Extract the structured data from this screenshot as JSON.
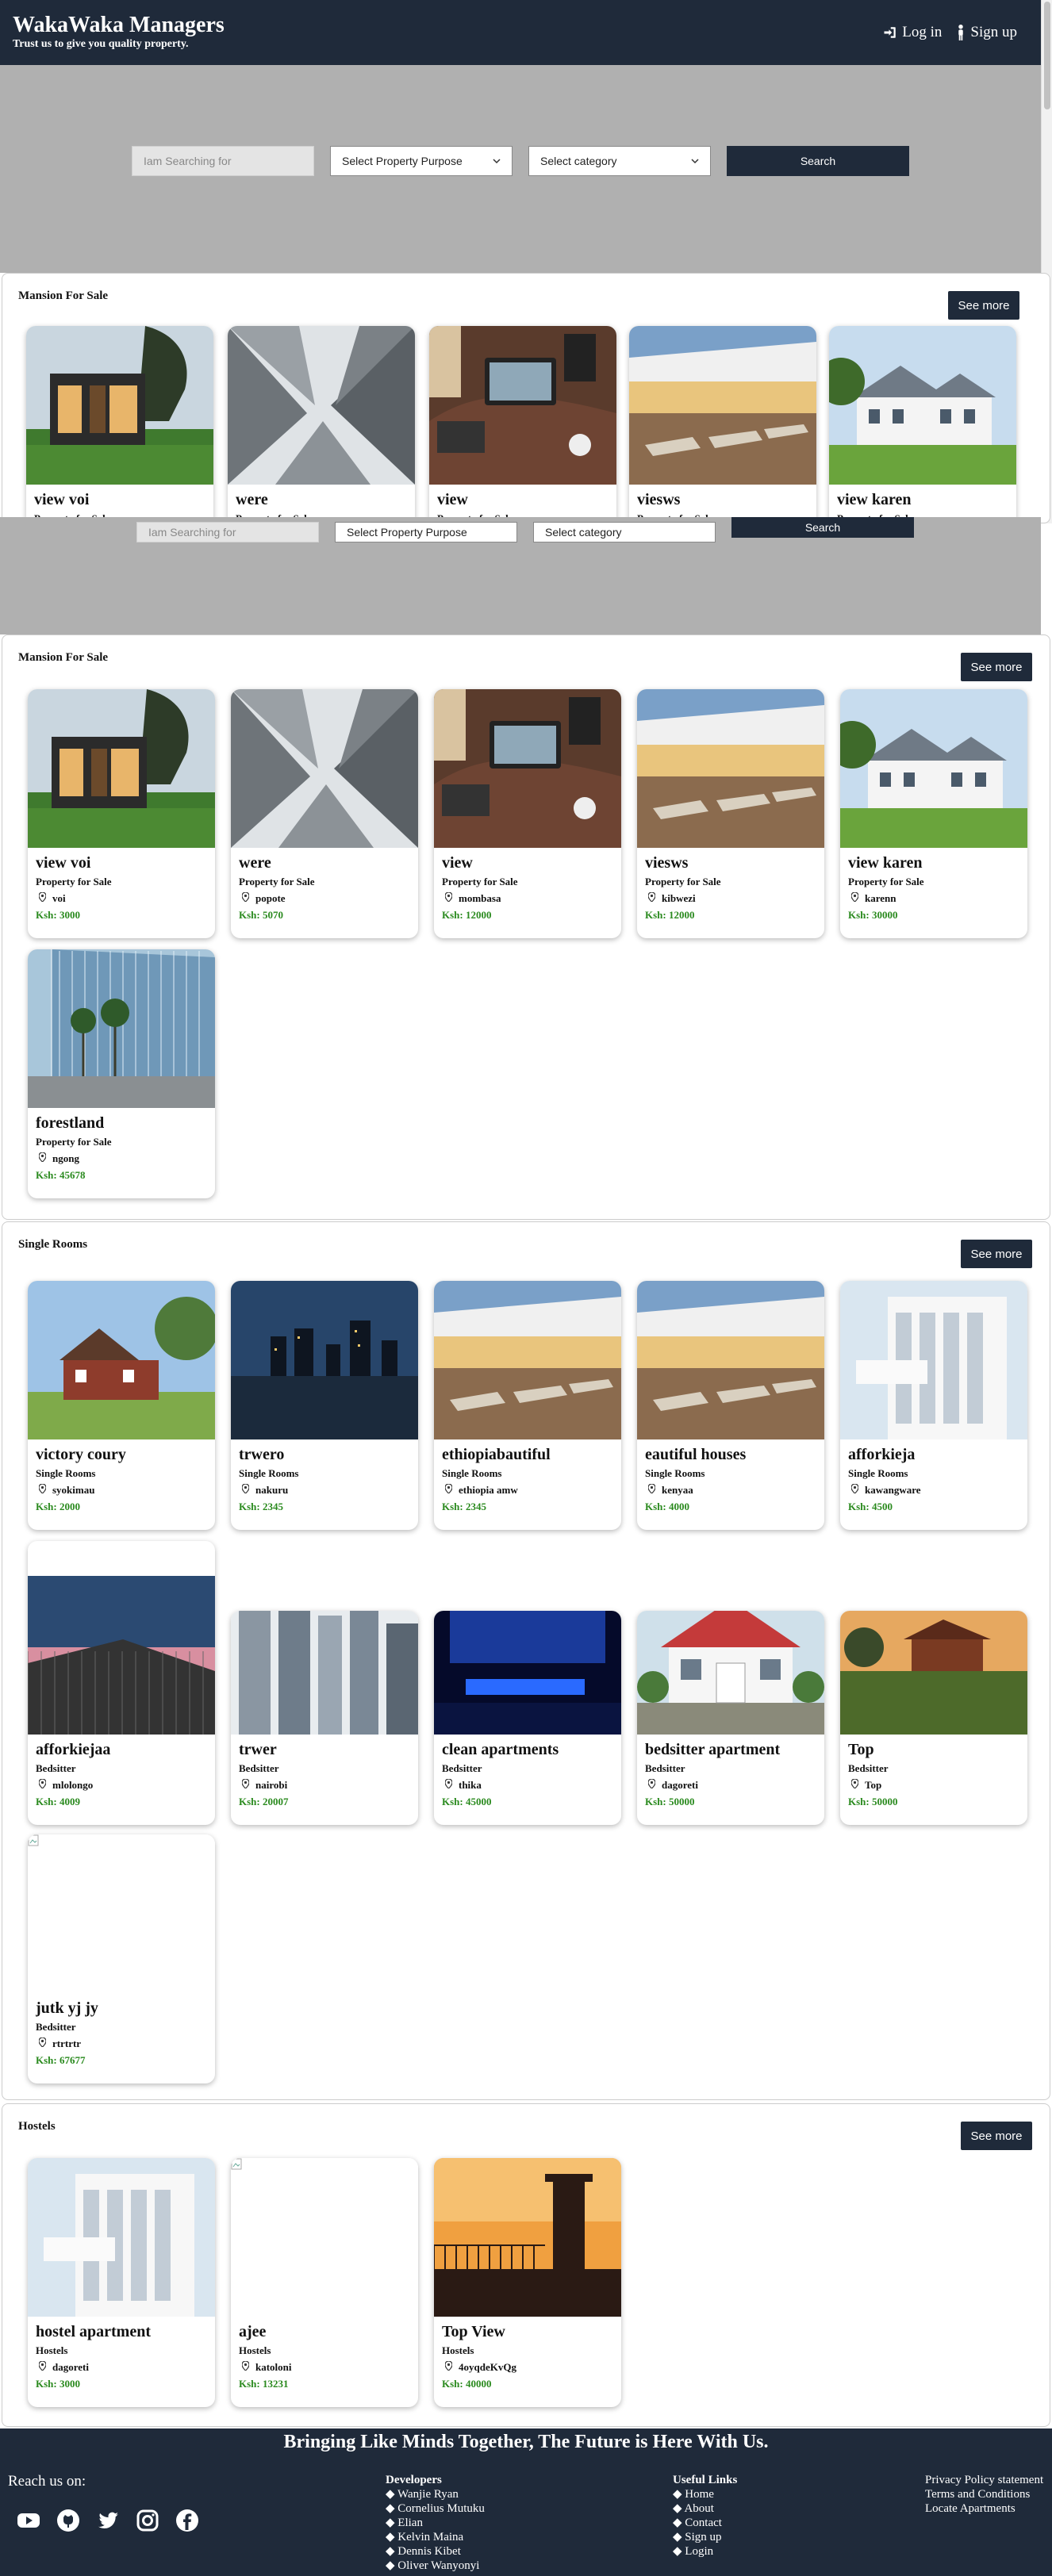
{
  "header": {
    "brand": "WakaWaka Managers",
    "tagline": "Trust us to give you quality property.",
    "login": "Log in",
    "signup": "Sign up"
  },
  "search": {
    "placeholder": "Iam Searching for",
    "purpose": "Select Property Purpose",
    "category": "Select category",
    "button": "Search"
  },
  "see_more": "See more",
  "sections": {
    "sale": {
      "title": "Mansion For Sale",
      "cards": [
        {
          "title": "view voi",
          "category": "Property for Sale",
          "location": "voi",
          "price": "Ksh: 3000",
          "image": "modern-house-trees"
        },
        {
          "title": "were",
          "category": "Property for Sale",
          "location": "popote",
          "price": "Ksh: 5070",
          "image": "skyscrapers-looking-up"
        },
        {
          "title": "view",
          "category": "Property for Sale",
          "location": "mombasa",
          "price": "Ksh: 12000",
          "image": "office-desk"
        },
        {
          "title": "viesws",
          "category": "Property for Sale",
          "location": "kibwezi",
          "price": "Ksh: 12000",
          "image": "patio-lounge"
        },
        {
          "title": "view karen",
          "category": "Property for Sale",
          "location": "karenn",
          "price": "Ksh: 30000",
          "image": "white-house-lawn"
        },
        {
          "title": "forestland",
          "category": "Property for Sale",
          "location": "ngong",
          "price": "Ksh: 45678",
          "image": "glass-building-palms"
        }
      ]
    },
    "single": {
      "title": "Single Rooms",
      "cards": [
        {
          "title": "victory coury",
          "category": "Single Rooms",
          "location": "syokimau",
          "price": "Ksh: 2000",
          "image": "brick-house"
        },
        {
          "title": "trwero",
          "category": "Single Rooms",
          "location": "nakuru",
          "price": "Ksh: 2345",
          "image": "city-skyline-night"
        },
        {
          "title": "ethiopiabautiful",
          "category": "Single Rooms",
          "location": "ethiopia amw",
          "price": "Ksh: 2345",
          "image": "patio-lounge"
        },
        {
          "title": "eautiful houses",
          "category": "Single Rooms",
          "location": "kenyaa",
          "price": "Ksh: 4000",
          "image": "patio-lounge"
        },
        {
          "title": "afforkieja",
          "category": "Single Rooms",
          "location": "kawangware",
          "price": "Ksh: 4500",
          "image": "white-building"
        },
        {
          "title": "afforkiejaa",
          "category": "Bedsitter",
          "location": "mlolongo",
          "price": "Ksh: 4009",
          "image": "tall-building-dusk"
        },
        {
          "title": "trwer",
          "category": "Bedsitter",
          "location": "nairobi",
          "price": "Ksh: 20007",
          "image": "skyscrapers-wide"
        },
        {
          "title": "clean apartments",
          "category": "Bedsitter",
          "location": "thika",
          "price": "Ksh: 45000",
          "image": "blue-lit-room"
        },
        {
          "title": "bedsitter apartment",
          "category": "Bedsitter",
          "location": "dagoreti",
          "price": "Ksh: 50000",
          "image": "white-cottage"
        },
        {
          "title": "Top",
          "category": "Bedsitter",
          "location": "Top",
          "price": "Ksh: 50000",
          "image": "wooden-lodge"
        },
        {
          "title": "jutk yj jy",
          "category": "Bedsitter",
          "location": "rtrtrtr",
          "price": "Ksh: 67677",
          "image": "broken"
        }
      ]
    },
    "hostels": {
      "title": "Hostels",
      "cards": [
        {
          "title": "hostel apartment",
          "category": "Hostels",
          "location": "dagoreti",
          "price": "Ksh: 3000",
          "image": "white-building"
        },
        {
          "title": "ajee",
          "category": "Hostels",
          "location": "katoloni",
          "price": "Ksh: 13231",
          "image": "broken"
        },
        {
          "title": "Top View",
          "category": "Hostels",
          "location": "4oyqdeKvQg",
          "price": "Ksh: 40000",
          "image": "construction-sunset"
        }
      ]
    },
    "overlay": {
      "cards": [
        {
          "title": "view voi",
          "sub": "Property for Sale",
          "image": "modern-house-trees"
        },
        {
          "title": "were",
          "sub": "Property for Sale",
          "image": "skyscrapers-looking-up"
        },
        {
          "title": "view",
          "sub": "Property for Sale",
          "image": "office-desk"
        },
        {
          "title": "viesws",
          "sub": "Property for Sale",
          "image": "patio-lounge"
        },
        {
          "title": "view karen",
          "sub": "Property for Sale",
          "image": "white-house-lawn"
        }
      ]
    }
  },
  "footer": {
    "heading": "Bringing Like Minds Together, The Future is Here With Us.",
    "reach": "Reach us on:",
    "social": [
      "youtube-icon",
      "github-icon",
      "twitter-icon",
      "instagram-icon",
      "facebook-icon"
    ],
    "developers_title": "Developers",
    "developers": [
      "Wanjie Ryan",
      "Cornelius Mutuku",
      "Elian",
      "Kelvin Maina",
      "Dennis Kibet",
      "Oliver Wanyonyi"
    ],
    "links_title": "Useful Links",
    "links": [
      "Home",
      "About",
      "Contact",
      "Sign up",
      "Login"
    ],
    "policy": [
      "Privacy Policy statement",
      "Terms and Conditions",
      "Locate Apartments"
    ]
  },
  "colors": {
    "header_bg": "#1f2a3a",
    "search_band": "#b0b0b0",
    "price_green": "#2a8a1e"
  }
}
